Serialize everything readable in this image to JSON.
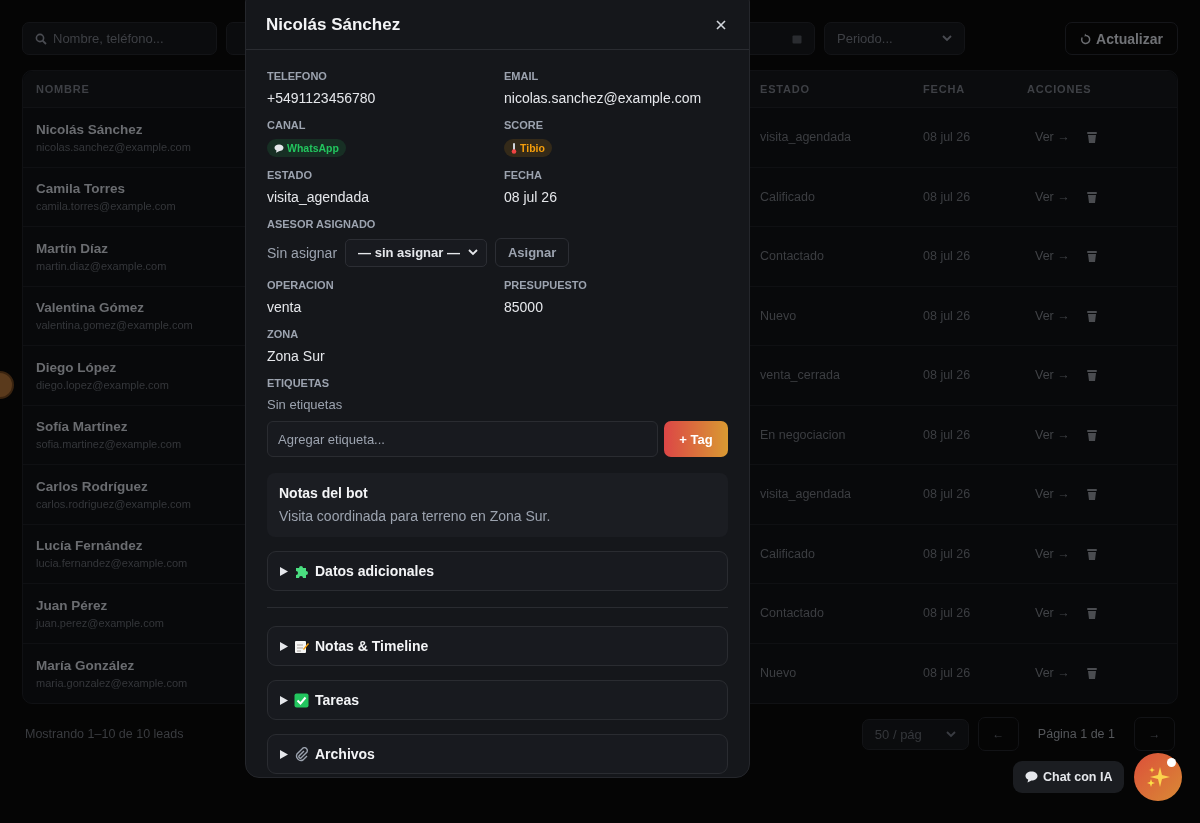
{
  "filters": {
    "search": {
      "placeholder": "Nombre, teléfono..."
    },
    "period": {
      "value": "Periodo..."
    },
    "refresh": {
      "label": "Actualizar"
    }
  },
  "table": {
    "columns": [
      "NOMBRE",
      "ESTADO",
      "FECHA",
      "ACCIONES"
    ],
    "rows": [
      {
        "name": "Nicolás Sánchez",
        "email": "nicolas.sanchez@example.com",
        "estado": "visita_agendada",
        "fecha": "08 jul 26",
        "action": "Ver →"
      },
      {
        "name": "Camila Torres",
        "email": "camila.torres@example.com",
        "estado": "Calificado",
        "fecha": "08 jul 26",
        "action": "Ver →"
      },
      {
        "name": "Martín Díaz",
        "email": "martin.diaz@example.com",
        "estado": "Contactado",
        "fecha": "08 jul 26",
        "action": "Ver →"
      },
      {
        "name": "Valentina Gómez",
        "email": "valentina.gomez@example.com",
        "estado": "Nuevo",
        "fecha": "08 jul 26",
        "action": "Ver →"
      },
      {
        "name": "Diego López",
        "email": "diego.lopez@example.com",
        "estado": "venta_cerrada",
        "fecha": "08 jul 26",
        "action": "Ver →"
      },
      {
        "name": "Sofía Martínez",
        "email": "sofia.martinez@example.com",
        "estado": "En negociacion",
        "fecha": "08 jul 26",
        "action": "Ver →"
      },
      {
        "name": "Carlos Rodríguez",
        "email": "carlos.rodriguez@example.com",
        "estado": "visita_agendada",
        "fecha": "08 jul 26",
        "action": "Ver →"
      },
      {
        "name": "Lucía Fernández",
        "email": "lucia.fernandez@example.com",
        "estado": "Calificado",
        "fecha": "08 jul 26",
        "action": "Ver →"
      },
      {
        "name": "Juan Pérez",
        "email": "juan.perez@example.com",
        "estado": "Contactado",
        "fecha": "08 jul 26",
        "action": "Ver →"
      },
      {
        "name": "María González",
        "email": "maria.gonzalez@example.com",
        "estado": "Nuevo",
        "fecha": "08 jul 26",
        "action": "Ver →"
      }
    ]
  },
  "footer": {
    "summary": "Mostrando 1–10 de 10 leads",
    "page_size": "50 / pág",
    "prev": "←",
    "page": "Página 1 de 1",
    "next": "→"
  },
  "chat": {
    "label": "Chat con IA",
    "unread": true
  },
  "modal": {
    "title": "Nicolás Sánchez",
    "fields": [
      {
        "kind": "text",
        "label": "TELEFONO",
        "value": "+5491123456780"
      },
      {
        "kind": "text",
        "label": "EMAIL",
        "value": "nicolas.sanchez@example.com"
      },
      {
        "kind": "chip",
        "label": "CANAL",
        "value": "WhatsApp",
        "color": "#22c55e"
      },
      {
        "kind": "chip",
        "label": "SCORE",
        "value": "Tibio",
        "color": "#f59e0b"
      },
      {
        "kind": "text",
        "label": "ESTADO",
        "value": "visita_agendada"
      },
      {
        "kind": "text",
        "label": "FECHA",
        "value": "08 jul 26"
      },
      {
        "kind": "assign",
        "label": "ASESOR ASIGNADO",
        "value": "Sin asignar",
        "select": "— sin asignar —",
        "button": "Asignar"
      },
      {
        "kind": "text",
        "label": "OPERACION",
        "value": "venta"
      },
      {
        "kind": "text",
        "label": "PRESUPUESTO",
        "value": "85000"
      },
      {
        "kind": "text",
        "label": "ZONA",
        "value": "Zona Sur"
      }
    ],
    "tags": {
      "label": "ETIQUETAS",
      "empty": "Sin etiquetas",
      "placeholder": "Agregar etiqueta...",
      "button": "+ Tag"
    },
    "bot_notes": {
      "title": "Notas del bot",
      "text": "Visita coordinada para terreno en Zona Sur."
    },
    "sections": [
      {
        "label": "Datos adicionales",
        "expanded": false
      },
      {
        "label": "Notas & Timeline",
        "expanded": false
      },
      {
        "label": "Tareas",
        "expanded": false
      },
      {
        "label": "Archivos",
        "expanded": false
      }
    ]
  }
}
